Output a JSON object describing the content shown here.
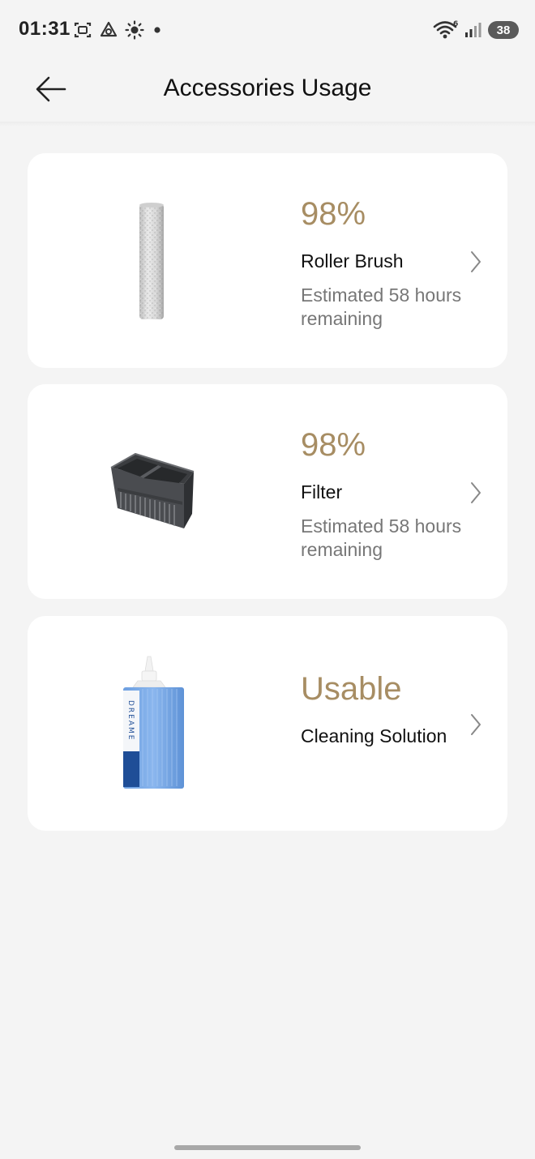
{
  "status_bar": {
    "time": "01:31",
    "battery": "38",
    "left_icons": [
      "screenshot-icon",
      "recycle-icon",
      "brightness-icon",
      "dot-icon"
    ],
    "right_icons": [
      "wifi-icon",
      "signal-icon",
      "battery-icon"
    ]
  },
  "header": {
    "title": "Accessories Usage",
    "back_icon": "arrow-left-icon"
  },
  "accessories": [
    {
      "status": "98%",
      "name": "Roller Brush",
      "remaining": "Estimated 58 hours remaining",
      "image": "roller-brush-image"
    },
    {
      "status": "98%",
      "name": "Filter",
      "remaining": "Estimated 58 hours remaining",
      "image": "filter-image"
    },
    {
      "status": "Usable",
      "name": "Cleaning Solution",
      "remaining": "",
      "image": "cleaning-solution-image"
    }
  ],
  "bottle_label": "DREAME",
  "colors": {
    "accent": "#a78d63",
    "background": "#f4f4f4",
    "card": "#ffffff"
  }
}
